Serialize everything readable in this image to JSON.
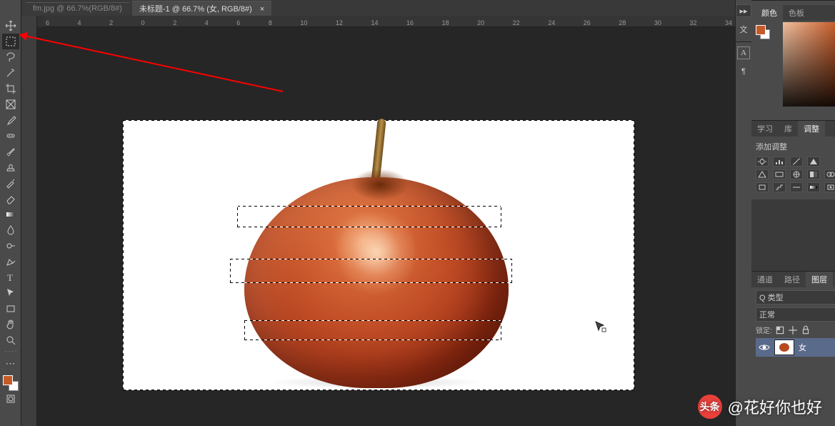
{
  "tabs": {
    "inactive": "fm.jpg @ 66.7%(RGB/8#)",
    "active": "未标题-1 @ 66.7% (女, RGB/8#)"
  },
  "ruler": {
    "marks": [
      "6",
      "4",
      "2",
      "0",
      "2",
      "4",
      "6",
      "8",
      "10",
      "12",
      "14",
      "16",
      "18",
      "20",
      "22",
      "24",
      "26",
      "28",
      "30",
      "32",
      "34"
    ]
  },
  "rightdock": {
    "icons": {
      "doc": "文",
      "a": "A",
      "para": "¶"
    }
  },
  "color_panel": {
    "tab1": "颜色",
    "tab2": "色板"
  },
  "learn_panel": {
    "tab1": "学习",
    "tab2": "库",
    "tab3": "调整",
    "title": "添加调整"
  },
  "layers_panel": {
    "tab1": "通道",
    "tab2": "路径",
    "tab3": "图层",
    "filter": "Q 类型",
    "blend": "正常",
    "lock_label": "锁定:",
    "layer_name": "女"
  },
  "watermark": {
    "badge": "头条",
    "text": "@花好你也好"
  }
}
